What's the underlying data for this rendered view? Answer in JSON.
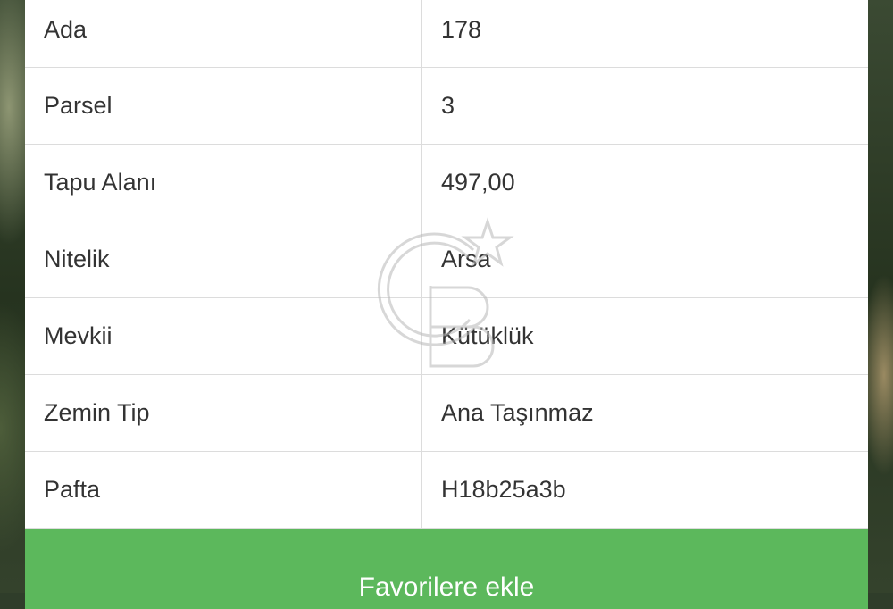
{
  "details": {
    "rows": [
      {
        "label": "Ada",
        "value": "178"
      },
      {
        "label": "Parsel",
        "value": "3"
      },
      {
        "label": "Tapu Alanı",
        "value": "497,00"
      },
      {
        "label": "Nitelik",
        "value": "Arsa"
      },
      {
        "label": "Mevkii",
        "value": "Kütüklük"
      },
      {
        "label": "Zemin Tip",
        "value": "Ana Taşınmaz"
      },
      {
        "label": "Pafta",
        "value": "H18b25a3b"
      }
    ]
  },
  "actions": {
    "favorite_label": "Favorilere ekle"
  },
  "colors": {
    "accent": "#5cb85c",
    "text": "#333333",
    "divider": "#dcdcdc"
  },
  "watermark": {
    "logo_text": "CB"
  }
}
